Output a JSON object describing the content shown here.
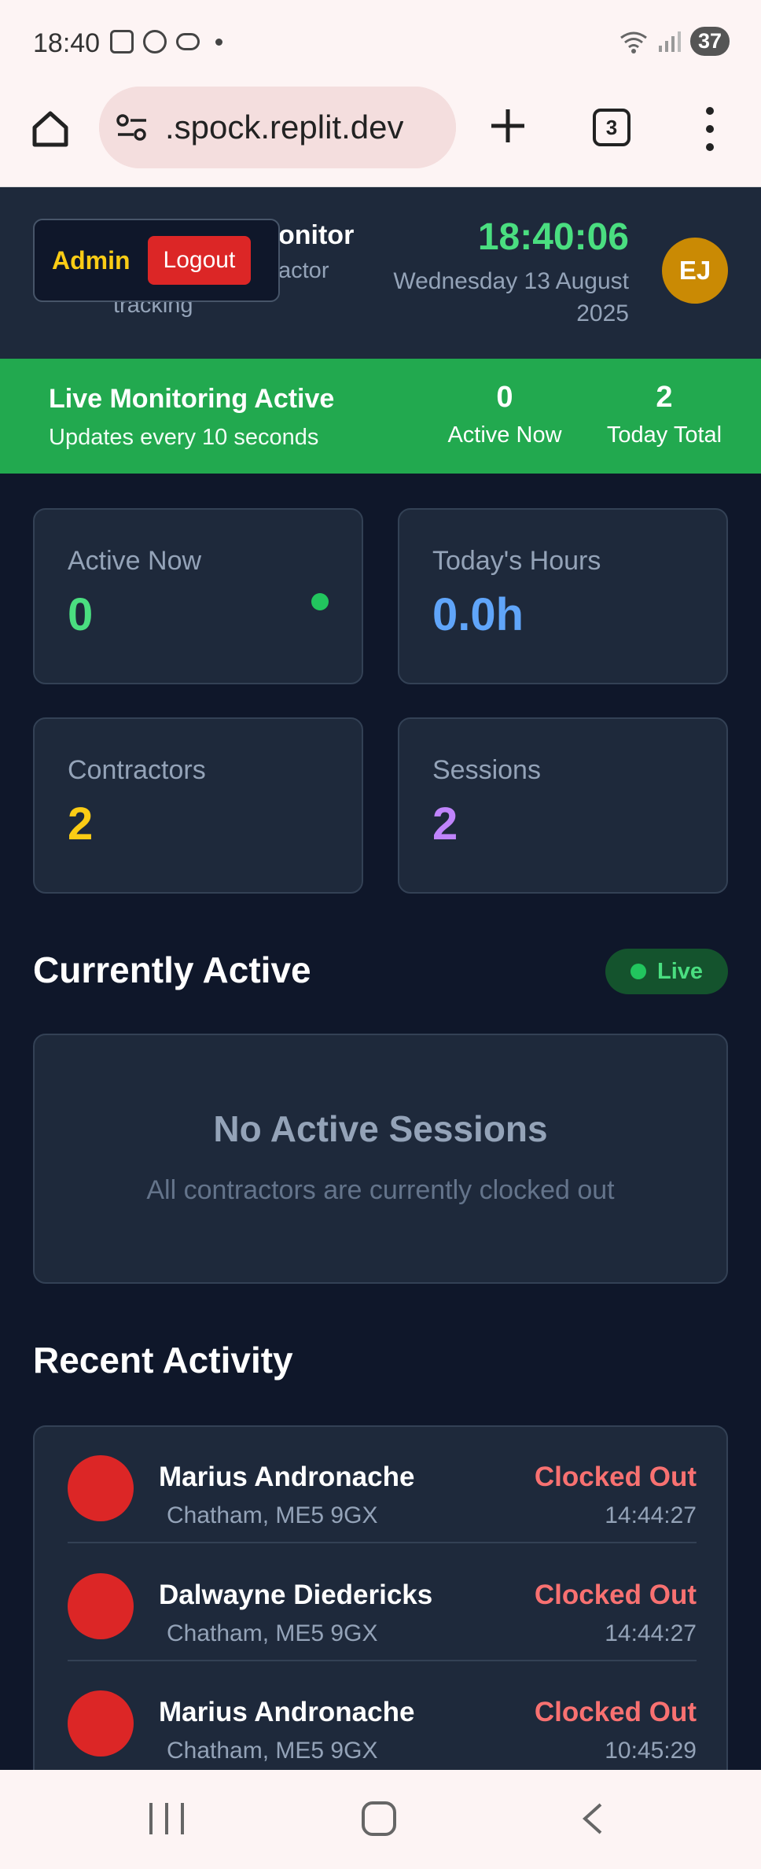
{
  "status_bar": {
    "time": "18:40",
    "battery": "37"
  },
  "browser": {
    "url": ".spock.replit.dev",
    "tab_count": "3"
  },
  "header": {
    "title_partial": "onitor",
    "subtitle_partial": "actor",
    "subtitle_line2": "tracking",
    "admin_label": "Admin",
    "logout_label": "Logout",
    "clock": "18:40:06",
    "date": "Wednesday 13 August 2025",
    "avatar_initials": "EJ"
  },
  "banner": {
    "title": "Live Monitoring Active",
    "subtitle": "Updates every 10 seconds",
    "active_now_value": "0",
    "active_now_label": "Active Now",
    "today_total_value": "2",
    "today_total_label": "Today Total"
  },
  "stats": {
    "active_now": {
      "label": "Active Now",
      "value": "0"
    },
    "todays_hours": {
      "label": "Today's Hours",
      "value": "0.0h"
    },
    "contractors": {
      "label": "Contractors",
      "value": "2"
    },
    "sessions": {
      "label": "Sessions",
      "value": "2"
    }
  },
  "currently_active": {
    "title": "Currently Active",
    "live_label": "Live",
    "empty_title": "No Active Sessions",
    "empty_subtitle": "All contractors are currently clocked out"
  },
  "recent_activity": {
    "title": "Recent Activity",
    "items": [
      {
        "name": "Marius Andronache",
        "location": "Chatham, ME5 9GX",
        "status": "Clocked Out",
        "time": "14:44:27"
      },
      {
        "name": "Dalwayne Diedericks",
        "location": "Chatham, ME5 9GX",
        "status": "Clocked Out",
        "time": "14:44:27"
      },
      {
        "name": "Marius Andronache",
        "location": "Chatham, ME5 9GX",
        "status": "Clocked Out",
        "time": "10:45:29"
      }
    ]
  },
  "colors": {
    "accent_green": "#4ade80",
    "banner_green": "#22a94f",
    "logout_red": "#dc2626",
    "admin_yellow": "#facc15",
    "avatar_gold": "#ca8a04"
  }
}
